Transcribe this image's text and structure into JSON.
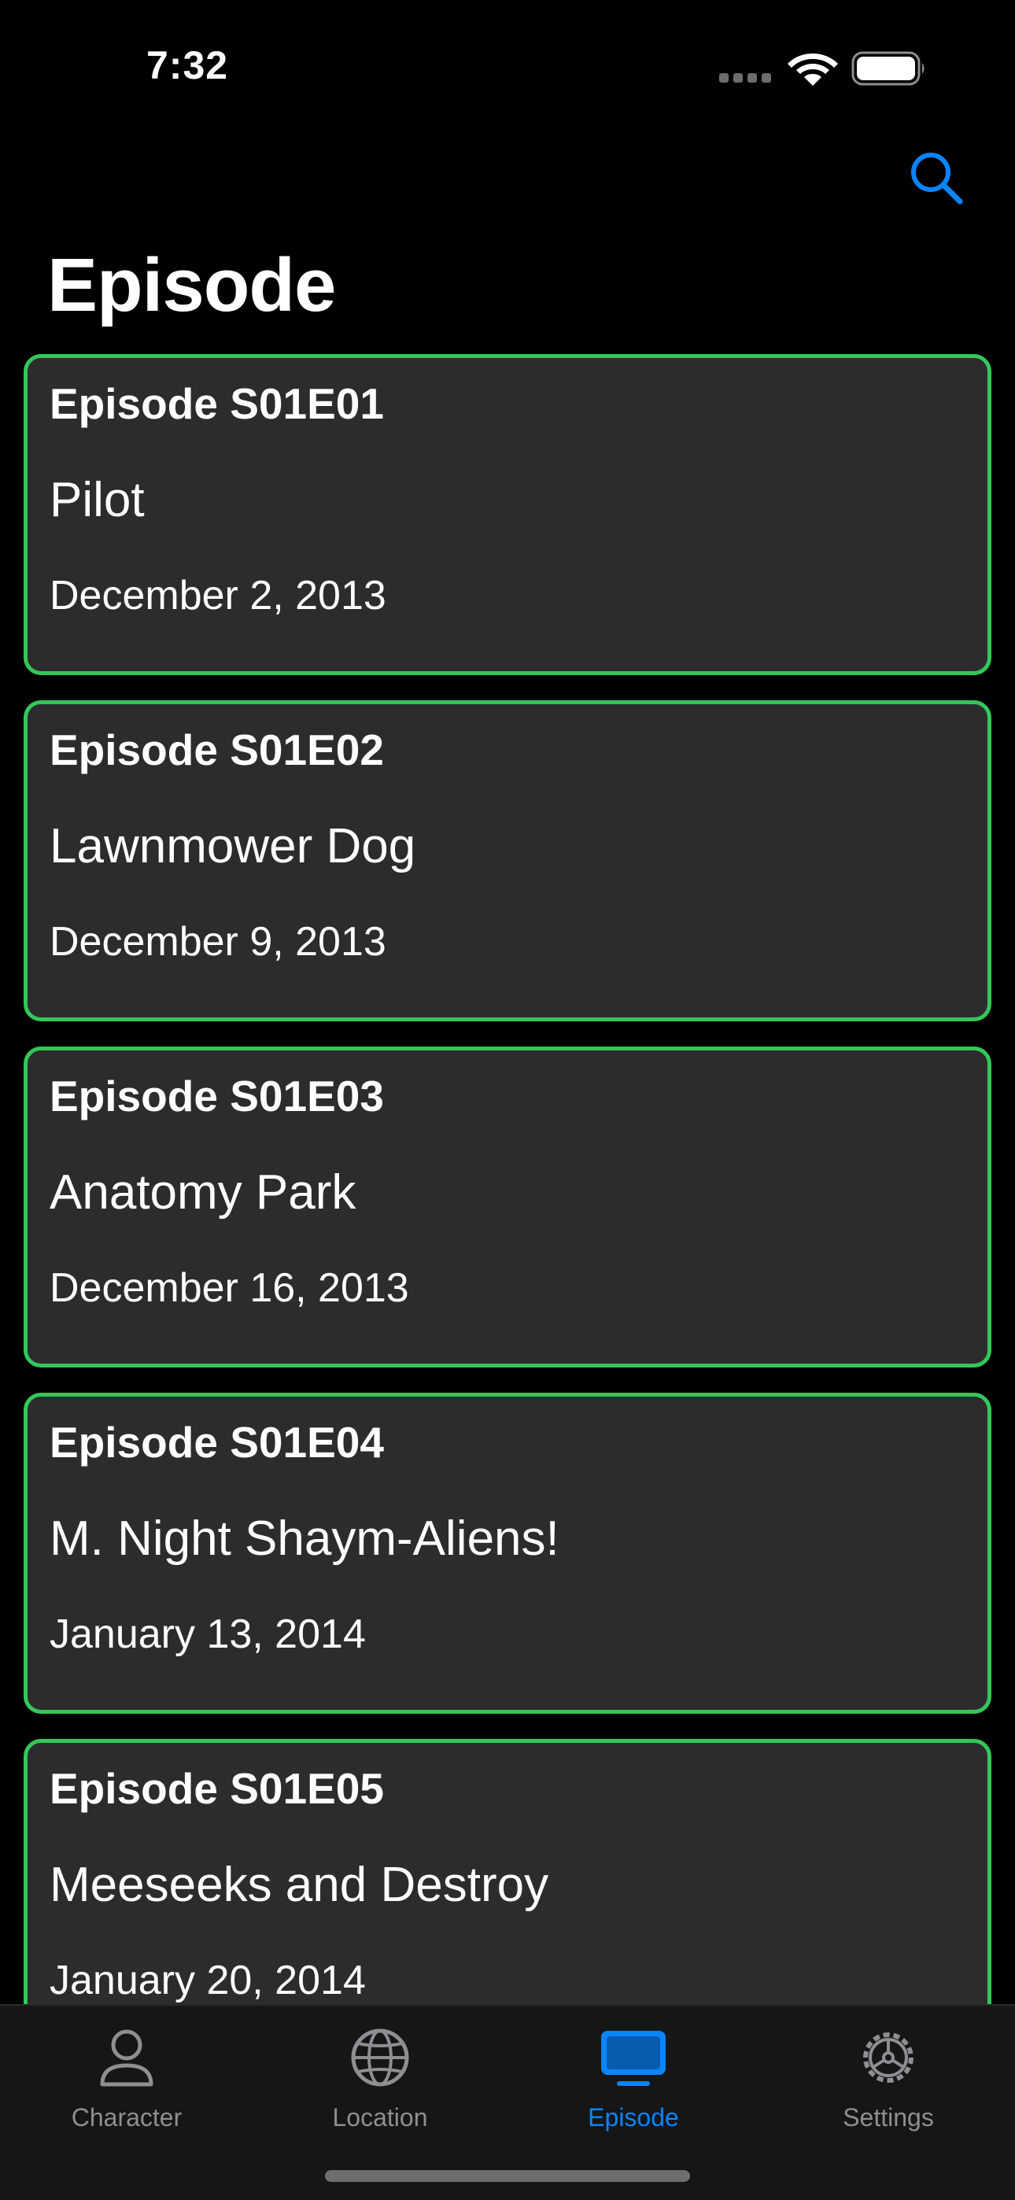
{
  "status_bar": {
    "time": "7:32"
  },
  "header": {
    "title": "Episode",
    "search_icon": "magnifying-glass"
  },
  "episodes": [
    {
      "code": "Episode S01E01",
      "name": "Pilot",
      "air_date": "December 2, 2013"
    },
    {
      "code": "Episode S01E02",
      "name": "Lawnmower Dog",
      "air_date": "December 9, 2013"
    },
    {
      "code": "Episode S01E03",
      "name": "Anatomy Park",
      "air_date": "December 16, 2013"
    },
    {
      "code": "Episode S01E04",
      "name": "M. Night Shaym-Aliens!",
      "air_date": "January 13, 2014"
    },
    {
      "code": "Episode S01E05",
      "name": "Meeseeks and Destroy",
      "air_date": "January 20, 2014"
    }
  ],
  "tab_bar": {
    "tabs": [
      {
        "label": "Character",
        "icon": "person-icon",
        "active": false
      },
      {
        "label": "Location",
        "icon": "globe-icon",
        "active": false
      },
      {
        "label": "Episode",
        "icon": "tv-icon",
        "active": true
      },
      {
        "label": "Settings",
        "icon": "gear-icon",
        "active": false
      }
    ]
  },
  "colors": {
    "background": "#000000",
    "card_background": "#2c2c2e",
    "card_border": "#34c759",
    "accent": "#0a84ff",
    "inactive_tab": "#8e8e93"
  }
}
